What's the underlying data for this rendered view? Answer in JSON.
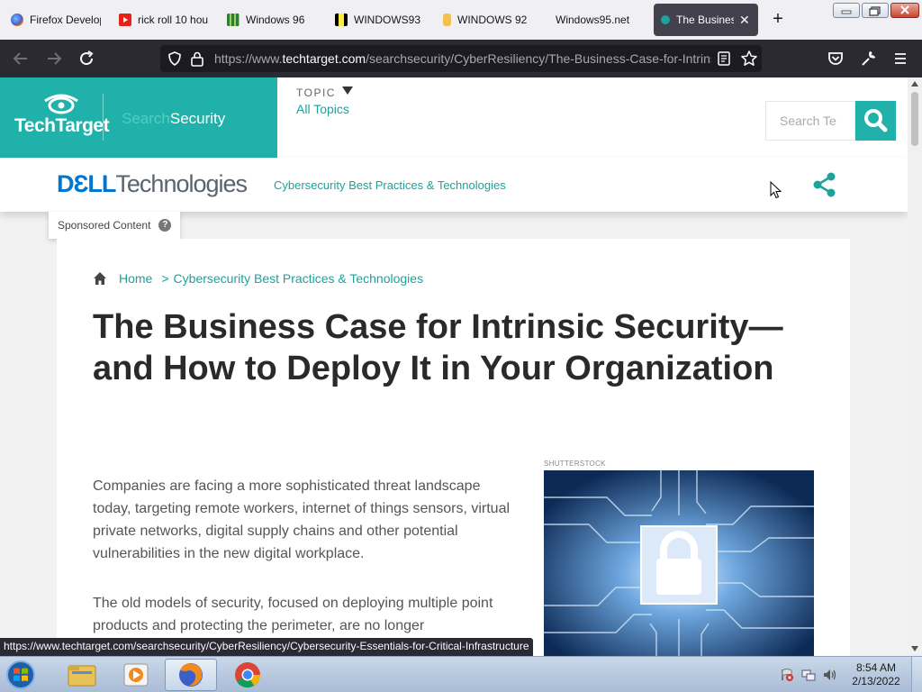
{
  "browser": {
    "tabs": [
      {
        "title": "Firefox Develop",
        "icon": "firefox-icon",
        "color": "#4a7bd6"
      },
      {
        "title": "rick roll 10 hou",
        "icon": "youtube-icon",
        "color": "#e62117"
      },
      {
        "title": "Windows 96",
        "icon": "windows96-icon",
        "color": "#2e7d32"
      },
      {
        "title": "WINDOWS93",
        "icon": "windows93-icon",
        "color": "#c9b400"
      },
      {
        "title": "WINDOWS 92",
        "icon": "windows92-icon",
        "color": "#e0a800"
      },
      {
        "title": "Windows95.net",
        "icon": "",
        "color": ""
      },
      {
        "title": "The Business",
        "icon": "techtarget-icon",
        "color": "#1ba39c",
        "active": true
      }
    ],
    "new_tab": "+",
    "window_controls": {
      "minimize": "—",
      "maximize": "❐",
      "close": "✕"
    },
    "url_prefix": "https://www.",
    "url_domain": "techtarget.com",
    "url_path": "/searchsecurity/CyberResiliency/The-Business-Case-for-Intrinsic",
    "status_url": "https://www.techtarget.com/searchsecurity/CyberResiliency/Cybersecurity-Essentials-for-Critical-Infrastructure"
  },
  "site": {
    "brand": "TechTarget",
    "section_prefix": "Search",
    "section_name": "Security",
    "topic_label": "TOPIC",
    "all_topics": "All Topics",
    "search_placeholder": "Search Te",
    "accent": "#20b2aa"
  },
  "sponsor": {
    "logo_dell": "DƐLL",
    "logo_tech": "Technologies",
    "category": "Cybersecurity Best Practices & Technologies",
    "sponsored_label": "Sponsored Content",
    "help": "?"
  },
  "article": {
    "breadcrumb_home": "Home",
    "breadcrumb_sep": ">",
    "breadcrumb_category": "Cybersecurity Best Practices & Technologies",
    "title": "The Business Case for Intrinsic Security—and How to Deploy It in Your Organization",
    "image_credit": "SHUTTERSTOCK",
    "paragraphs": [
      "Companies are facing a more sophisticated threat landscape today, targeting remote workers, internet of things sensors, virtual private networks, digital supply chains and other potential vulnerabilities in the new digital workplace.",
      "The old models of security, focused on deploying multiple point products and protecting the perimeter, are no longer"
    ]
  },
  "taskbar": {
    "time": "8:54 AM",
    "date": "2/13/2022",
    "apps": [
      "explorer-icon",
      "media-player-icon",
      "firefox-icon",
      "chrome-icon"
    ]
  }
}
